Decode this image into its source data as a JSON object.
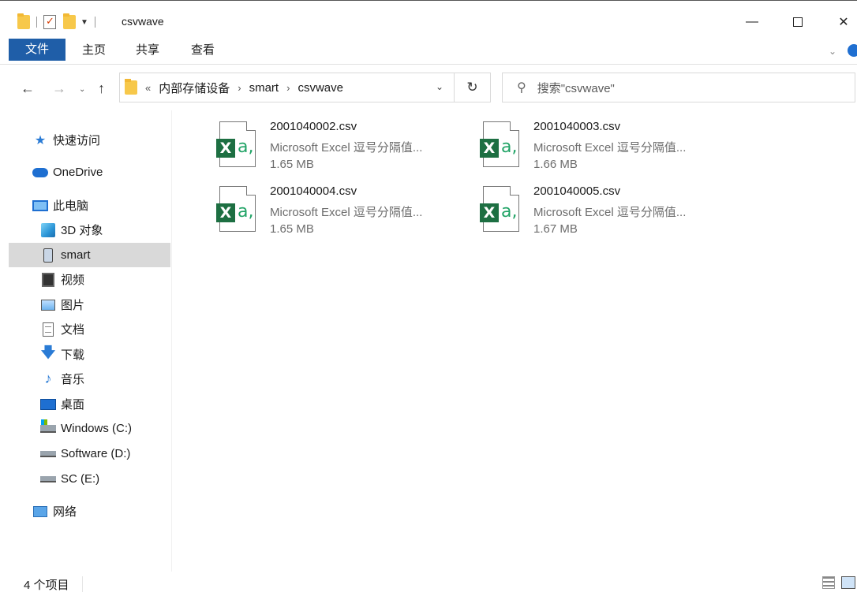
{
  "window": {
    "title": "csvwave",
    "minimize": "—",
    "close": "✕"
  },
  "ribbon": {
    "tabs": [
      "文件",
      "主页",
      "共享",
      "查看"
    ]
  },
  "nav": {
    "back": "←",
    "forward": "→",
    "recent": "⌄",
    "up": "↑",
    "breadcrumb_more": "«",
    "breadcrumb": [
      "内部存储设备",
      "smart",
      "csvwave"
    ],
    "crumb_sep": "›",
    "dropdown": "⌄",
    "refresh": "↻"
  },
  "search": {
    "placeholder": "搜索\"csvwave\""
  },
  "sidebar": {
    "items": [
      {
        "label": "快速访问",
        "icon": "star-icon"
      },
      {
        "label": "OneDrive",
        "icon": "cloud-icon"
      },
      {
        "label": "此电脑",
        "icon": "computer-icon"
      },
      {
        "label": "3D 对象",
        "icon": "3d-objects-icon"
      },
      {
        "label": "smart",
        "icon": "phone-device-icon",
        "selected": true
      },
      {
        "label": "视频",
        "icon": "video-icon"
      },
      {
        "label": "图片",
        "icon": "pictures-icon"
      },
      {
        "label": "文档",
        "icon": "documents-icon"
      },
      {
        "label": "下载",
        "icon": "download-icon"
      },
      {
        "label": "音乐",
        "icon": "music-icon"
      },
      {
        "label": "桌面",
        "icon": "desktop-icon"
      },
      {
        "label": "Windows (C:)",
        "icon": "windows-drive-icon"
      },
      {
        "label": "Software (D:)",
        "icon": "drive-icon"
      },
      {
        "label": "SC (E:)",
        "icon": "drive-icon"
      },
      {
        "label": "网络",
        "icon": "network-icon"
      }
    ]
  },
  "files": [
    {
      "name": "2001040002.csv",
      "type": "Microsoft Excel 逗号分隔值...",
      "size": "1.65 MB",
      "icon": "excel-csv-icon"
    },
    {
      "name": "2001040003.csv",
      "type": "Microsoft Excel 逗号分隔值...",
      "size": "1.66 MB",
      "icon": "excel-csv-icon"
    },
    {
      "name": "2001040004.csv",
      "type": "Microsoft Excel 逗号分隔值...",
      "size": "1.65 MB",
      "icon": "excel-csv-icon"
    },
    {
      "name": "2001040005.csv",
      "type": "Microsoft Excel 逗号分隔值...",
      "size": "1.67 MB",
      "icon": "excel-csv-icon"
    }
  ],
  "status": {
    "count": "4 个项目"
  },
  "colors": {
    "file_tab": "#1f5ea8",
    "selection": "#d9d9d9",
    "excel_green": "#1d6f42"
  }
}
